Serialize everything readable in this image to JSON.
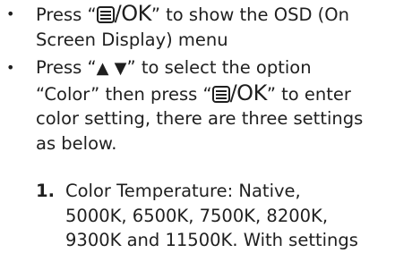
{
  "bullet_char": "•",
  "icons": {
    "menu": "menu-list-icon",
    "up": "up-triangle-icon",
    "down": "down-triangle-icon"
  },
  "colors": {
    "text": "#1f1f1f"
  },
  "bullet1": {
    "press": "Press “",
    "ok": "/OK",
    "after_ok": "” to show the OSD (On",
    "line2": "Screen Display) menu"
  },
  "bullet2": {
    "press": "Press “",
    "up": "▲",
    "down": "▼",
    "after_arrows": "” to select the option",
    "line2_pre": "“Color” then press “",
    "ok": "/OK",
    "line2_post": "” to enter",
    "line3": "color setting, there are three settings",
    "line4": "as below."
  },
  "item1": {
    "number": "1.",
    "line1": "Color Temperature: Native,",
    "line2": "5000K, 6500K, 7500K, 8200K,",
    "line3": "9300K and 11500K. With settings"
  }
}
